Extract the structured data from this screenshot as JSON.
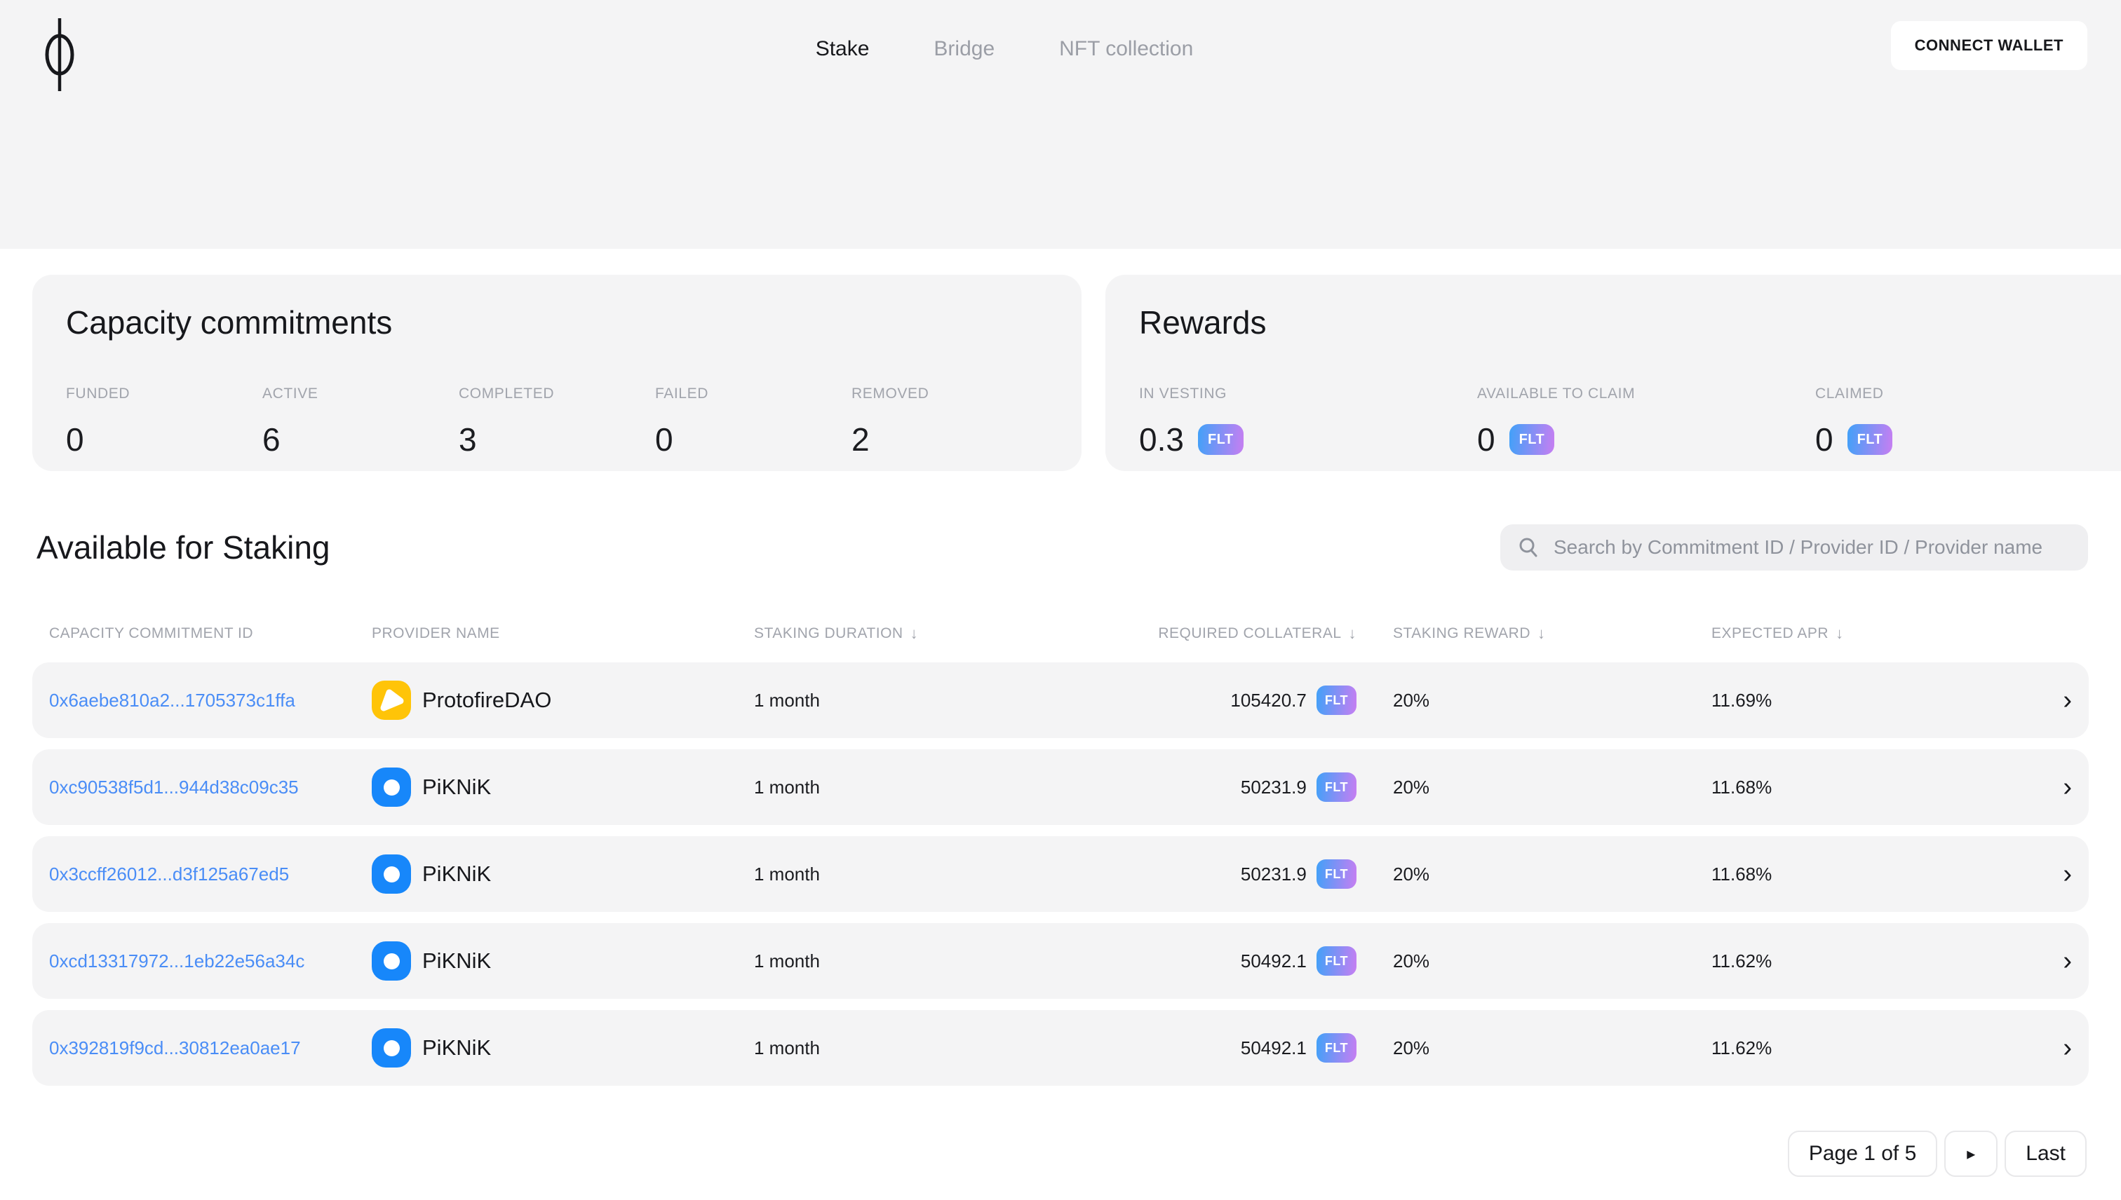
{
  "header": {
    "nav": {
      "items": [
        {
          "label": "Stake",
          "active": true
        },
        {
          "label": "Bridge",
          "active": false
        },
        {
          "label": "NFT collection",
          "active": false
        }
      ]
    },
    "connect_wallet": "CONNECT WALLET"
  },
  "capacity": {
    "title": "Capacity commitments",
    "stats": [
      {
        "label": "FUNDED",
        "value": "0"
      },
      {
        "label": "ACTIVE",
        "value": "6"
      },
      {
        "label": "COMPLETED",
        "value": "3"
      },
      {
        "label": "FAILED",
        "value": "0"
      },
      {
        "label": "REMOVED",
        "value": "2"
      }
    ]
  },
  "rewards": {
    "title": "Rewards",
    "stats": [
      {
        "label": "IN VESTING",
        "value": "0.3",
        "unit": "FLT"
      },
      {
        "label": "AVAILABLE TO CLAIM",
        "value": "0",
        "unit": "FLT"
      },
      {
        "label": "CLAIMED",
        "value": "0",
        "unit": "FLT"
      }
    ]
  },
  "staking": {
    "title": "Available for Staking",
    "search_placeholder": "Search by Commitment ID / Provider ID / Provider name",
    "columns": [
      {
        "label": "CAPACITY COMMITMENT ID",
        "sort": ""
      },
      {
        "label": "PROVIDER NAME",
        "sort": ""
      },
      {
        "label": "STAKING DURATION",
        "sort": "↓"
      },
      {
        "label": "REQUIRED COLLATERAL",
        "sort": "↓"
      },
      {
        "label": "STAKING REWARD",
        "sort": "↓"
      },
      {
        "label": "EXPECTED APR",
        "sort": "↓"
      }
    ],
    "rows": [
      {
        "id": "0x6aebe810a2...1705373c1ffa",
        "provider": "ProtofireDAO",
        "avatar": "protofire",
        "avatar_color": "#FFC408",
        "duration": "1 month",
        "collateral": "105420.7",
        "unit": "FLT",
        "reward": "20%",
        "apr": "11.69%"
      },
      {
        "id": "0xc90538f5d1...944d38c09c35",
        "provider": "PiKNiK",
        "avatar": "piknik",
        "avatar_color": "#1787FA",
        "duration": "1 month",
        "collateral": "50231.9",
        "unit": "FLT",
        "reward": "20%",
        "apr": "11.68%"
      },
      {
        "id": "0x3ccff26012...d3f125a67ed5",
        "provider": "PiKNiK",
        "avatar": "piknik",
        "avatar_color": "#1787FA",
        "duration": "1 month",
        "collateral": "50231.9",
        "unit": "FLT",
        "reward": "20%",
        "apr": "11.68%"
      },
      {
        "id": "0xcd13317972...1eb22e56a34c",
        "provider": "PiKNiK",
        "avatar": "piknik",
        "avatar_color": "#1787FA",
        "duration": "1 month",
        "collateral": "50492.1",
        "unit": "FLT",
        "reward": "20%",
        "apr": "11.62%"
      },
      {
        "id": "0x392819f9cd...30812ea0ae17",
        "provider": "PiKNiK",
        "avatar": "piknik",
        "avatar_color": "#1787FA",
        "duration": "1 month",
        "collateral": "50492.1",
        "unit": "FLT",
        "reward": "20%",
        "apr": "11.62%"
      }
    ]
  },
  "pagination": {
    "page_label": "Page 1 of 5",
    "next_icon": "▸",
    "last_label": "Last"
  },
  "icons": {
    "chevron_right": "›"
  },
  "colors": {
    "surface": "#F4F4F5",
    "accent_link": "#4A8DF6",
    "flt_badge_start": "#41A1F8",
    "flt_badge_end": "#C77EF2",
    "protofire_yellow": "#FFC408",
    "piknik_blue": "#1787FA"
  }
}
